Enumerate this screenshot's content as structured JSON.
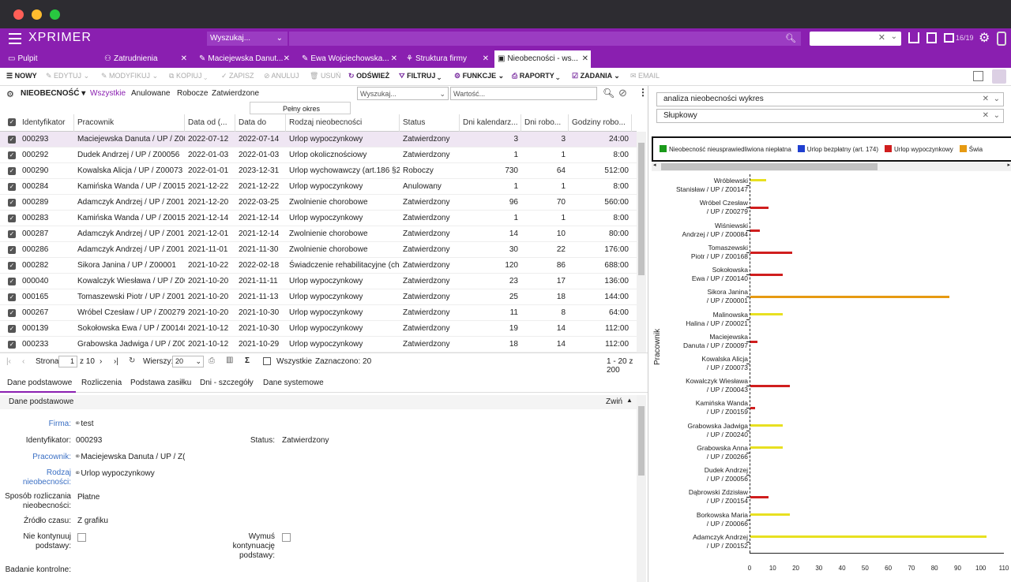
{
  "window": {
    "logo": "XPRIMER",
    "search_placeholder": "Wyszukaj...",
    "counter": "16/19"
  },
  "tabs": [
    {
      "label": "Pulpit",
      "closable": false
    },
    {
      "label": "Zatrudnienia",
      "closable": true
    },
    {
      "label": "Maciejewska Danut...",
      "closable": true
    },
    {
      "label": "Ewa Wojciechowska...",
      "closable": true
    },
    {
      "label": "Struktura firmy",
      "closable": true
    },
    {
      "label": "Nieobecności - ws...",
      "closable": true,
      "active": true
    }
  ],
  "toolbar": {
    "new": "NOWY",
    "edit": "EDYTUJ",
    "modify": "MODYFIKUJ",
    "copy": "KOPIUJ",
    "save": "ZAPISZ",
    "cancel": "ANULUJ",
    "delete": "USUŃ",
    "refresh": "ODŚWIEŻ",
    "filter": "FILTRUJ",
    "functions": "FUNKCJE",
    "reports": "RAPORTY",
    "tasks": "ZADANIA",
    "email": "EMAIL"
  },
  "filters": {
    "type": "NIEOBECNOŚĆ",
    "all": "Wszystkie",
    "cancelled": "Anulowane",
    "draft": "Robocze",
    "approved": "Zatwierdzone",
    "period": "Pełny okres",
    "search_placeholder": "Wyszukaj...",
    "value_placeholder": "Wartość..."
  },
  "grid": {
    "headers": [
      "Identyfikator",
      "Pracownik",
      "Data od (...",
      "Data do",
      "Rodzaj nieobecności",
      "Status",
      "Dni kalendarz...",
      "Dni robo...",
      "Godziny robo..."
    ],
    "rows": [
      [
        "000293",
        "Maciejewska Danuta / UP / Z00(",
        "2022-07-12",
        "2022-07-14",
        "Urlop wypoczynkowy",
        "Zatwierdzony",
        "3",
        "3",
        "24:00"
      ],
      [
        "000292",
        "Dudek Andrzej / UP / Z00056",
        "2022-01-03",
        "2022-01-03",
        "Urlop okolicznościowy",
        "Zatwierdzony",
        "1",
        "1",
        "8:00"
      ],
      [
        "000290",
        "Kowalska Alicja / UP / Z00073",
        "2022-01-01",
        "2023-12-31",
        "Urlop wychowawczy (art.186 §2)",
        "Roboczy",
        "730",
        "64",
        "512:00"
      ],
      [
        "000284",
        "Kamińska Wanda / UP / Z00159",
        "2021-12-22",
        "2021-12-22",
        "Urlop wypoczynkowy",
        "Anulowany",
        "1",
        "1",
        "8:00"
      ],
      [
        "000289",
        "Adamczyk Andrzej / UP / Z0015",
        "2021-12-20",
        "2022-03-25",
        "Zwolnienie chorobowe",
        "Zatwierdzony",
        "96",
        "70",
        "560:00"
      ],
      [
        "000283",
        "Kamińska Wanda / UP / Z00159",
        "2021-12-14",
        "2021-12-14",
        "Urlop wypoczynkowy",
        "Zatwierdzony",
        "1",
        "1",
        "8:00"
      ],
      [
        "000287",
        "Adamczyk Andrzej / UP / Z0015",
        "2021-12-01",
        "2021-12-14",
        "Zwolnienie chorobowe",
        "Zatwierdzony",
        "14",
        "10",
        "80:00"
      ],
      [
        "000286",
        "Adamczyk Andrzej / UP / Z0015",
        "2021-11-01",
        "2021-11-30",
        "Zwolnienie chorobowe",
        "Zatwierdzony",
        "30",
        "22",
        "176:00"
      ],
      [
        "000282",
        "Sikora Janina / UP / Z00001",
        "2021-10-22",
        "2022-02-18",
        "Świadczenie rehabilitacyjne (cho",
        "Zatwierdzony",
        "120",
        "86",
        "688:00"
      ],
      [
        "000040",
        "Kowalczyk Wiesława / UP / Z00(",
        "2021-10-20",
        "2021-11-11",
        "Urlop wypoczynkowy",
        "Zatwierdzony",
        "23",
        "17",
        "136:00"
      ],
      [
        "000165",
        "Tomaszewski Piotr / UP / Z0016",
        "2021-10-20",
        "2021-11-13",
        "Urlop wypoczynkowy",
        "Zatwierdzony",
        "25",
        "18",
        "144:00"
      ],
      [
        "000267",
        "Wróbel Czesław / UP / Z00279",
        "2021-10-20",
        "2021-10-30",
        "Urlop wypoczynkowy",
        "Zatwierdzony",
        "11",
        "8",
        "64:00"
      ],
      [
        "000139",
        "Sokołowska Ewa / UP / Z00140",
        "2021-10-12",
        "2021-10-30",
        "Urlop wypoczynkowy",
        "Zatwierdzony",
        "19",
        "14",
        "112:00"
      ],
      [
        "000233",
        "Grabowska Jadwiga / UP / Z002",
        "2021-10-12",
        "2021-10-29",
        "Urlop wypoczynkowy",
        "Zatwierdzony",
        "18",
        "14",
        "112:00"
      ]
    ]
  },
  "pager": {
    "page_label": "Strona",
    "page": "1",
    "of": "z 10",
    "rows_label": "Wierszy:",
    "rows": "20",
    "all_label": "Wszystkie",
    "selected": "Zaznaczono: 20",
    "range": "1 - 20 z 200"
  },
  "detail_tabs": [
    "Dane podstawowe",
    "Rozliczenia",
    "Podstawa zasiłku",
    "Dni - szczegóły",
    "Dane systemowe"
  ],
  "detail": {
    "section": "Dane podstawowe",
    "collapse": "Zwiń",
    "firma_label": "Firma:",
    "firma": "test",
    "id_label": "Identyfikator:",
    "id": "000293",
    "status_label": "Status:",
    "status": "Zatwierdzony",
    "employee_label": "Pracownik:",
    "employee": "Maciejewska Danuta / UP / Z(",
    "type_label_1": "Rodzaj",
    "type_label_2": "nieobecności:",
    "type": "Urlop wypoczynkowy",
    "settle_label_1": "Sposób rozliczania",
    "settle_label_2": "nieobecności:",
    "settle": "Płatne",
    "source_label": "Źródło czasu:",
    "source": "Z grafiku",
    "nocont_label_1": "Nie kontynuuj",
    "nocont_label_2": "podstawy:",
    "force_label_1": "Wymuś",
    "force_label_2": "kontynuację",
    "force_label_3": "podstawy:",
    "exam_label": "Badanie kontrolne:"
  },
  "analysis": {
    "report": "analiza nieobecności wykres",
    "chart_type": "Słupkowy"
  },
  "chart_data": {
    "type": "bar",
    "orientation": "horizontal",
    "ylabel": "Pracownik",
    "xlim": [
      0,
      110
    ],
    "xticks": [
      "0",
      "10",
      "20",
      "30",
      "40",
      "50",
      "60",
      "70",
      "80",
      "90",
      "100",
      "110"
    ],
    "legend": [
      {
        "name": "Nieobecność nieusprawiedliwiona niepłatna",
        "color": "#1a9a1a"
      },
      {
        "name": "Urlop bezpłatny (art. 174)",
        "color": "#1f3fd0"
      },
      {
        "name": "Urlop wypoczynkowy",
        "color": "#d01e1e"
      },
      {
        "name": "Świa",
        "color": "#e69a12"
      }
    ],
    "categories": [
      {
        "l1": "Wróblewski",
        "l2": "Stanisław / UP / Z00147",
        "yellow": 7,
        "red": 0,
        "orange": 0
      },
      {
        "l1": "Wróbel Czesław",
        "l2": "/ UP / Z00279",
        "yellow": 0,
        "red": 8,
        "orange": 0
      },
      {
        "l1": "Wiśniewski",
        "l2": "Andrzej / UP / Z00084",
        "yellow": 0,
        "red": 4,
        "orange": 0
      },
      {
        "l1": "Tomaszewski",
        "l2": "Piotr / UP / Z00168",
        "yellow": 0,
        "red": 18,
        "orange": 0
      },
      {
        "l1": "Sokołowska",
        "l2": "Ewa / UP / Z00140",
        "yellow": 0,
        "red": 14,
        "orange": 0
      },
      {
        "l1": "Sikora Janina",
        "l2": "/ UP / Z00001",
        "yellow": 0,
        "red": 0,
        "orange": 86
      },
      {
        "l1": "Malinowska",
        "l2": "Halina / UP / Z00021",
        "yellow": 14,
        "red": 0,
        "orange": 0
      },
      {
        "l1": "Maciejewska",
        "l2": "Danuta / UP / Z00097",
        "yellow": 0,
        "red": 3,
        "orange": 0
      },
      {
        "l1": "Kowalska Alicja",
        "l2": "/ UP / Z00073",
        "yellow": 0,
        "red": 0,
        "orange": 0
      },
      {
        "l1": "Kowalczyk Wiesława",
        "l2": "/ UP / Z00043",
        "yellow": 0,
        "red": 17,
        "orange": 0
      },
      {
        "l1": "Kamińska Wanda",
        "l2": "/ UP / Z00159",
        "yellow": 0,
        "red": 2,
        "orange": 0
      },
      {
        "l1": "Grabowska Jadwiga",
        "l2": "/ UP / Z00240",
        "yellow": 14,
        "red": 0,
        "orange": 0
      },
      {
        "l1": "Grabowska Anna",
        "l2": "/ UP / Z00266",
        "yellow": 14,
        "red": 0,
        "orange": 0
      },
      {
        "l1": "Dudek Andrzej",
        "l2": "/ UP / Z00056",
        "yellow": 0,
        "red": 0,
        "orange": 0
      },
      {
        "l1": "Dąbrowski Zdzisław",
        "l2": "/ UP / Z00154",
        "yellow": 0,
        "red": 8,
        "orange": 0
      },
      {
        "l1": "Borkowska Maria",
        "l2": "/ UP / Z00066",
        "yellow": 17,
        "red": 0,
        "orange": 0
      },
      {
        "l1": "Adamczyk Andrzej",
        "l2": "/ UP / Z00152",
        "yellow": 102,
        "red": 0,
        "orange": 0
      }
    ],
    "colors": {
      "yellow": "#e8e020",
      "red": "#d01e1e",
      "orange": "#e69a12"
    }
  }
}
